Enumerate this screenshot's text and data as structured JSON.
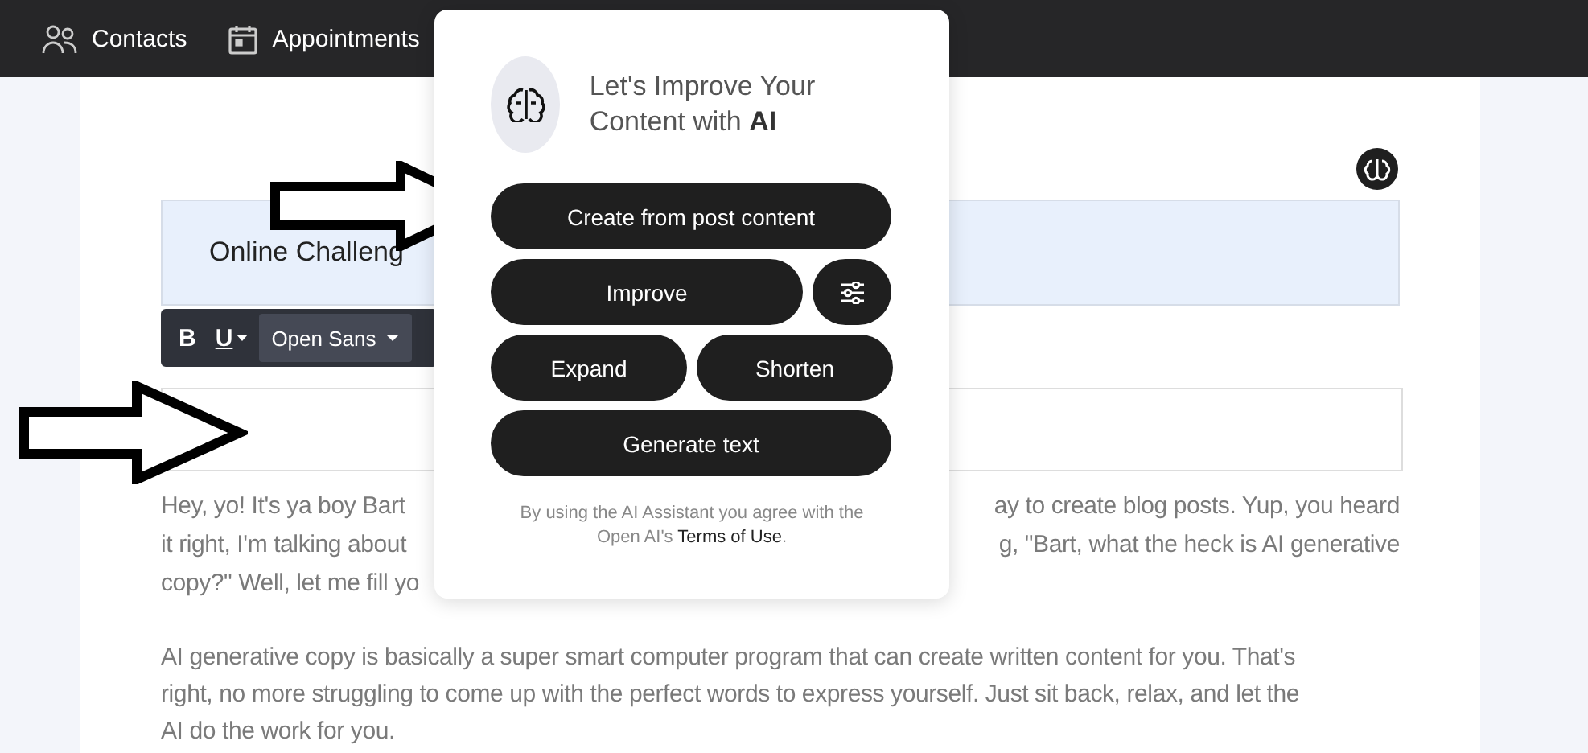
{
  "nav": [
    {
      "kind": "contacts",
      "label": "Contacts"
    },
    {
      "kind": "calendar",
      "label": "Appointments"
    }
  ],
  "editor": {
    "title": "Online Challeng",
    "toolbar": {
      "bold": "B",
      "underline": "U",
      "font": "Open Sans"
    },
    "paragraph_1": [
      {
        "left": "Hey, yo! It's ya boy Bart",
        "right": "ay to create blog posts. Yup, you heard"
      },
      {
        "left": "it right, I'm talking about",
        "right": "g, \"Bart, what the heck is AI generative"
      },
      {
        "left": "copy?\" Well, let me fill yo"
      }
    ],
    "paragraph_2": [
      "AI generative copy is basically a super smart computer program that can create written content for you. That's",
      "right, no more struggling to come up with the perfect words to express yourself. Just sit back, relax, and let the",
      "AI do the work for you."
    ]
  },
  "ai_popup": {
    "heading": "Let's Improve Your Content with **AI**",
    "buttons": [
      {
        "kind": "wide",
        "label": "Create from post content"
      },
      {
        "kind": "main",
        "label": "Improve"
      },
      {
        "kind": "settings"
      },
      {
        "kind": "half",
        "label": "Expand"
      },
      {
        "kind": "half",
        "label": "Shorten"
      },
      {
        "kind": "wide",
        "label": "Generate text"
      }
    ],
    "disclaimer": "By using the AI Assistant you agree with the Open AI's",
    "terms_link": "Terms of Use",
    "disclaimer_end": "."
  }
}
